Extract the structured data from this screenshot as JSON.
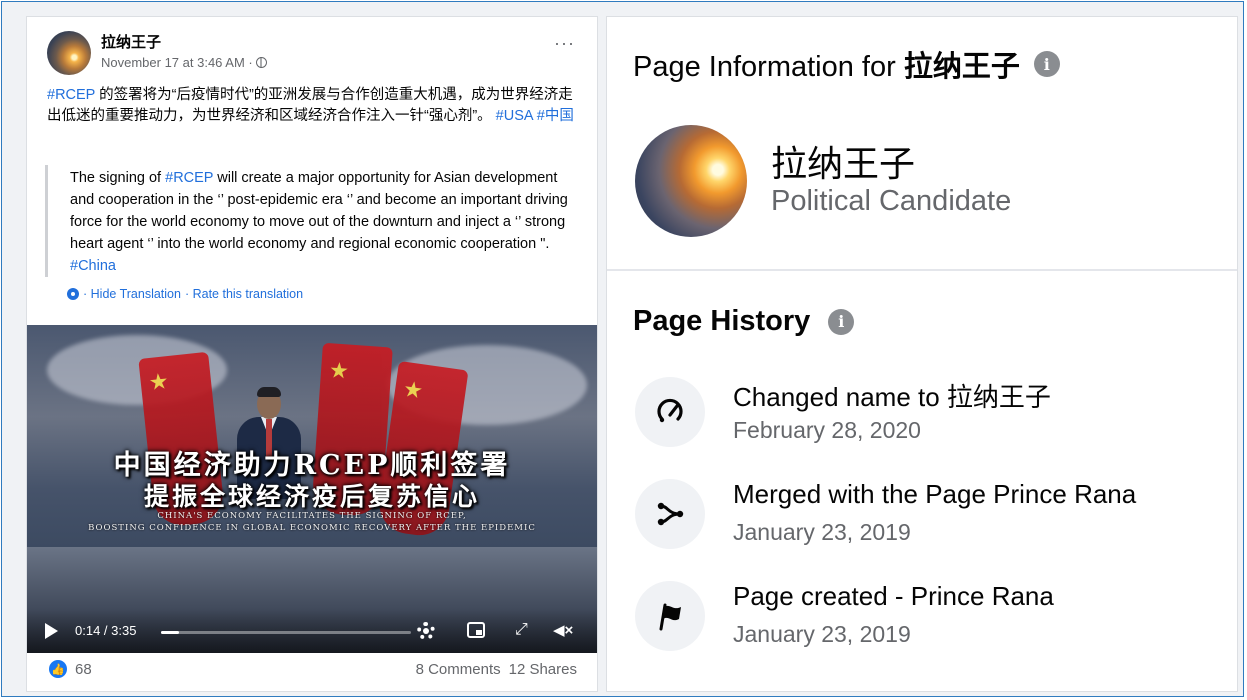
{
  "post": {
    "author": "拉纳王子",
    "timestamp": "November 17 at 3:46 AM · ",
    "text_hashtag_rcep": "#RCEP",
    "text_body": " 的签署将为“后疫情时代”的亚洲发展与合作创造重大机遇，成为世界经济走出低迷的重要推动力，为世界经济和区域经济合作注入一针“强心剂”。",
    "text_hashtags_end": " #USA #中国",
    "translation_prefix": "The signing of ",
    "translation_hashtag": "#RCEP",
    "translation_body": " will create a major opportunity for Asian development and cooperation in the ‘’ post-epidemic era ‘’ and become an important driving force for the world economy to move out of the downturn and inject a ‘’ strong heart agent ‘’ into the world economy and regional economic cooperation \". ",
    "translation_hashtag_end": "#China",
    "hide_translation": "· Hide Translation",
    "rate_translation": "· Rate this translation",
    "video": {
      "caption_line1": "中国经济助力RCEP顺利签署",
      "caption_line2": "提振全球经济疫后复苏信心",
      "caption_en_line1": "CHINA'S ECONOMY FACILITATES THE SIGNING OF RCEP,",
      "caption_en_line2": "BOOSTING CONFIDENCE IN GLOBAL ECONOMIC RECOVERY AFTER THE EPIDEMIC",
      "time": "0:14 / 3:35",
      "progress": 0.07
    },
    "likes": "68",
    "comments": "8 Comments",
    "shares": "12 Shares"
  },
  "page_info": {
    "title_prefix": "Page Information for ",
    "title_name": "拉纳王子",
    "info_glyph": "i",
    "name": "拉纳王子",
    "category": "Political Candidate",
    "history_title": "Page History",
    "history": [
      {
        "icon": "rename-icon",
        "title": "Changed name to 拉纳王子",
        "date": "February 28, 2020"
      },
      {
        "icon": "merge-icon",
        "title": "Merged with the Page Prince Rana",
        "date": "January 23, 2019"
      },
      {
        "icon": "flag-icon",
        "title": "Page created - Prince Rana",
        "date": "January 23, 2019"
      }
    ]
  },
  "colors": {
    "link": "#216fdb",
    "like": "#1877f2",
    "muted": "#65676b"
  }
}
